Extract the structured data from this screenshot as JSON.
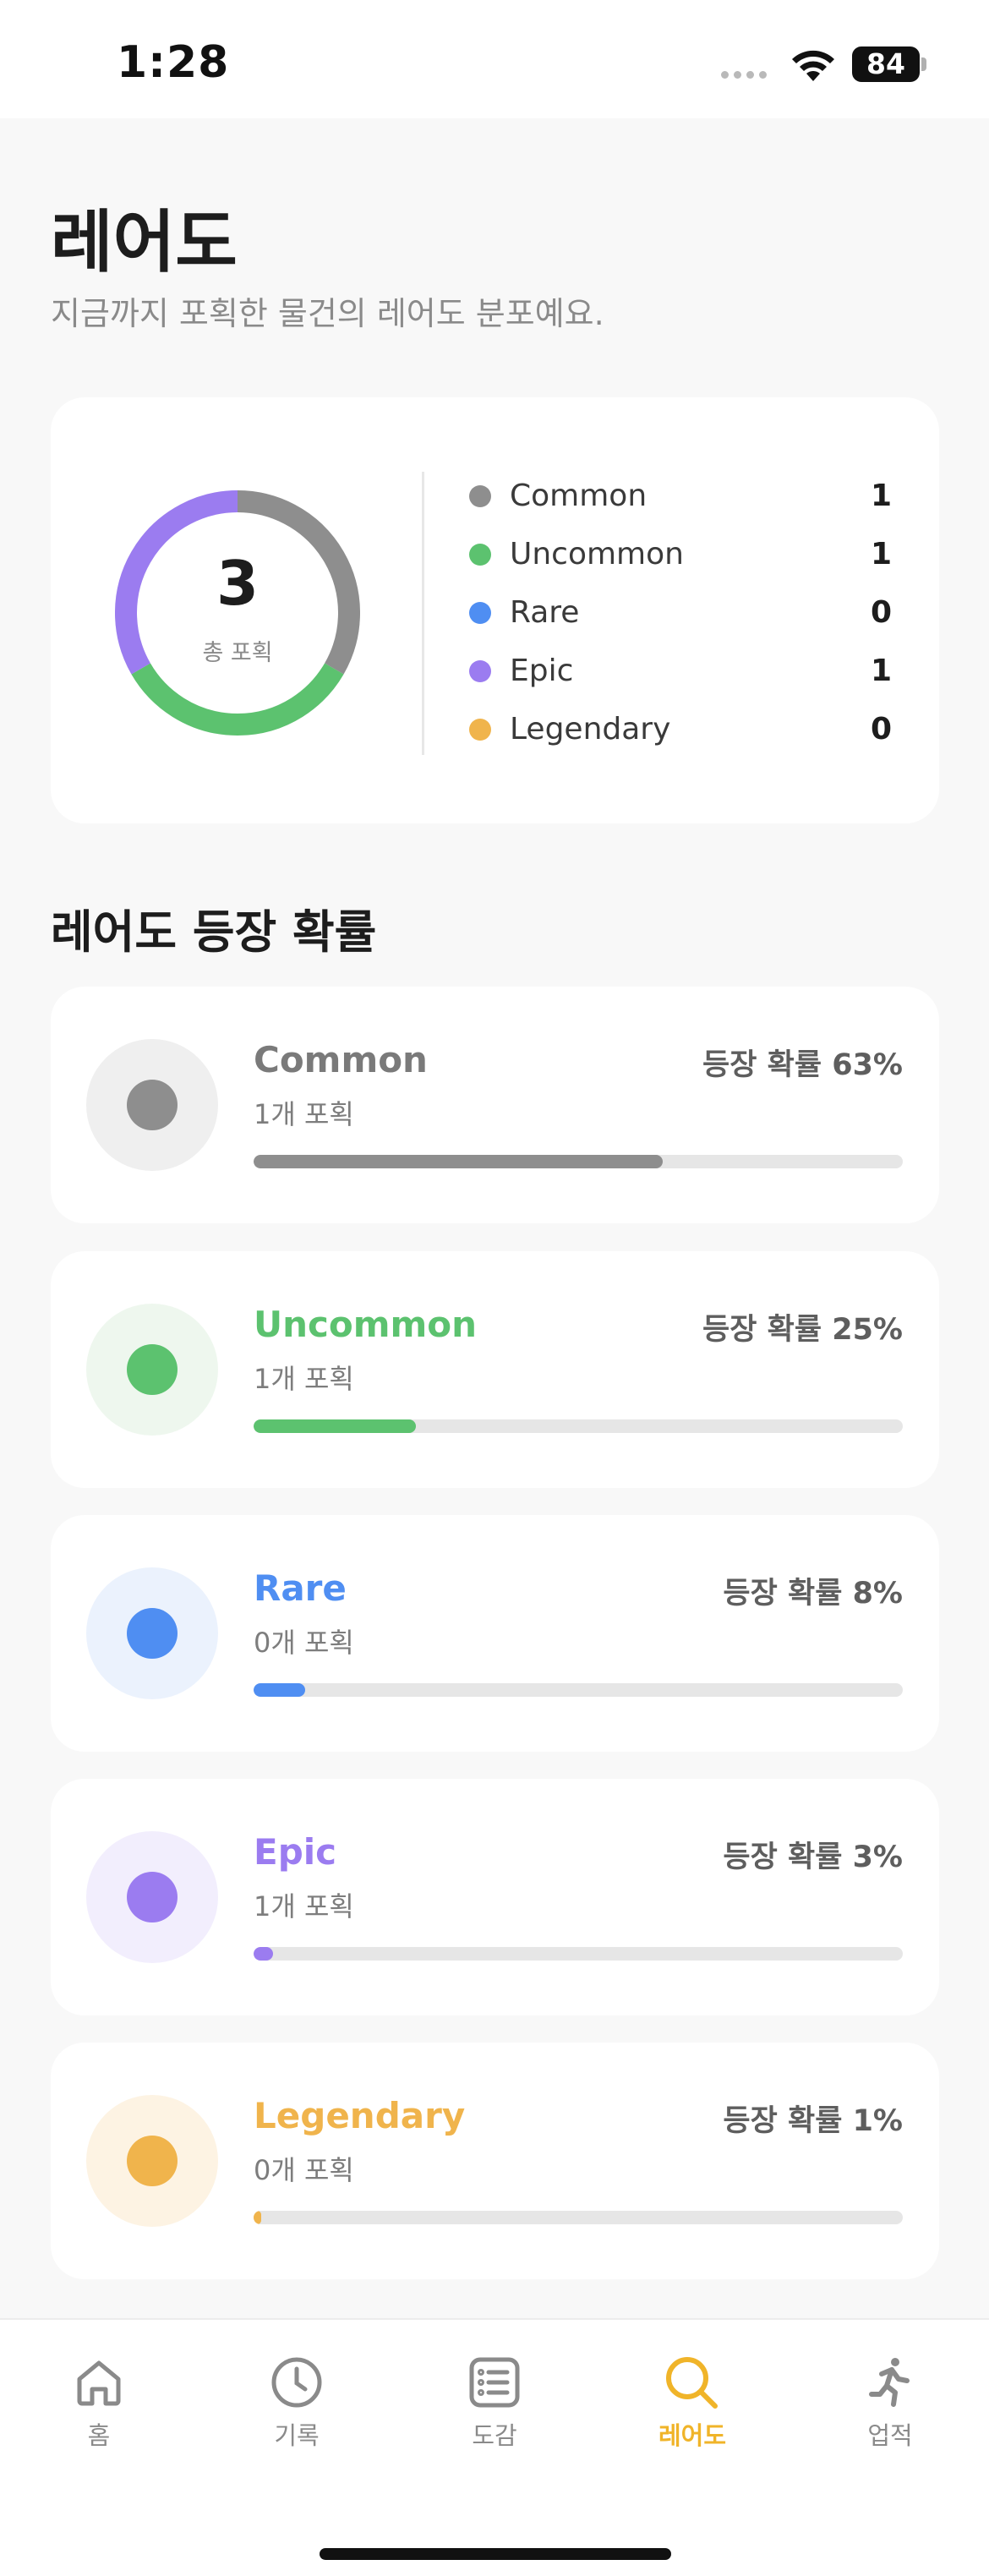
{
  "status_bar": {
    "time": "1:28",
    "battery": "84"
  },
  "header": {
    "title": "레어도",
    "subtitle": "지금까지 포획한 물건의 레어도 분포예요."
  },
  "summary": {
    "total": "3",
    "total_label": "총 포획",
    "legend": [
      {
        "name": "Common",
        "count": "1",
        "color": "#8e8e8e"
      },
      {
        "name": "Uncommon",
        "count": "1",
        "color": "#5cc26f"
      },
      {
        "name": "Rare",
        "count": "0",
        "color": "#4f8ef2"
      },
      {
        "name": "Epic",
        "count": "1",
        "color": "#9b7cf0"
      },
      {
        "name": "Legendary",
        "count": "0",
        "color": "#f0b44c"
      }
    ]
  },
  "section": {
    "title": "레어도 등장 확률"
  },
  "rarities": [
    {
      "name": "Common",
      "owned": "1개 포획",
      "probability_label": "등장 확률 63%",
      "probability": 0.63,
      "color": "#8e8e8e",
      "bg": "#efefef",
      "name_color": "#7a7a7a"
    },
    {
      "name": "Uncommon",
      "owned": "1개 포획",
      "probability_label": "등장 확률 25%",
      "probability": 0.25,
      "color": "#5cc26f",
      "bg": "#eef7ee",
      "name_color": "#5cc26f"
    },
    {
      "name": "Rare",
      "owned": "0개 포획",
      "probability_label": "등장 확률 8%",
      "probability": 0.08,
      "color": "#4f8ef2",
      "bg": "#ebf2fd",
      "name_color": "#4f8ef2"
    },
    {
      "name": "Epic",
      "owned": "1개 포획",
      "probability_label": "등장 확률 3%",
      "probability": 0.03,
      "color": "#9b7cf0",
      "bg": "#f2eefd",
      "name_color": "#9b7cf0"
    },
    {
      "name": "Legendary",
      "owned": "0개 포획",
      "probability_label": "등장 확률 1%",
      "probability": 0.01,
      "color": "#f0b44c",
      "bg": "#fdf3e3",
      "name_color": "#f0b44c"
    }
  ],
  "tabs": [
    {
      "label": "홈",
      "icon": "home-icon",
      "active": false
    },
    {
      "label": "기록",
      "icon": "clock-icon",
      "active": false
    },
    {
      "label": "도감",
      "icon": "list-icon",
      "active": false
    },
    {
      "label": "레어도",
      "icon": "search-icon",
      "active": true
    },
    {
      "label": "업적",
      "icon": "running-icon",
      "active": false
    }
  ],
  "accent_color": "#f0b429"
}
